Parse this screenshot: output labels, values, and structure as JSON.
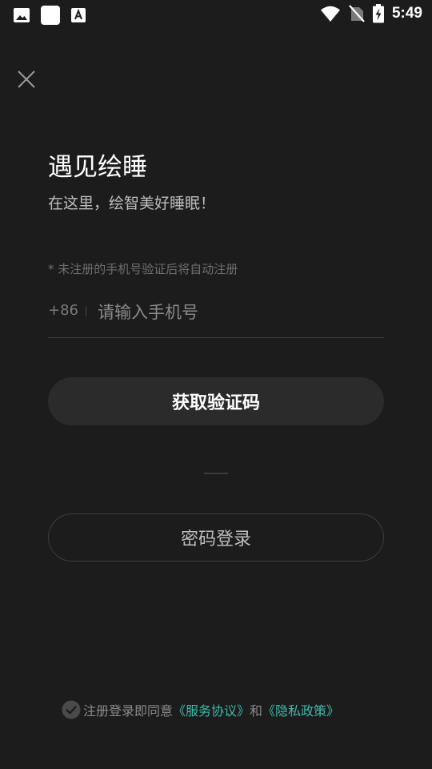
{
  "status_bar": {
    "time": "5:49",
    "left_icons": [
      "image-icon",
      "square-icon",
      "font-download-icon"
    ],
    "right_icons": [
      "wifi-icon",
      "no-sim-icon",
      "battery-charging-icon"
    ]
  },
  "header": {
    "close_icon": "close-icon"
  },
  "main": {
    "title": "遇见绘睡",
    "subtitle": "在这里，绘智美好睡眠！",
    "hint": "* 未注册的手机号验证后将自动注册",
    "country_code": "+86",
    "phone_placeholder": "请输入手机号",
    "phone_value": "",
    "get_code_label": "获取验证码",
    "password_login_label": "密码登录"
  },
  "agreement": {
    "prefix": "注册登录即同意",
    "service_link": "《服务协议》",
    "connector": "和",
    "privacy_link": "《隐私政策》"
  },
  "colors": {
    "background": "#1c1c1c",
    "button_fill": "#2b2b2b",
    "link": "#3fb9a9"
  }
}
